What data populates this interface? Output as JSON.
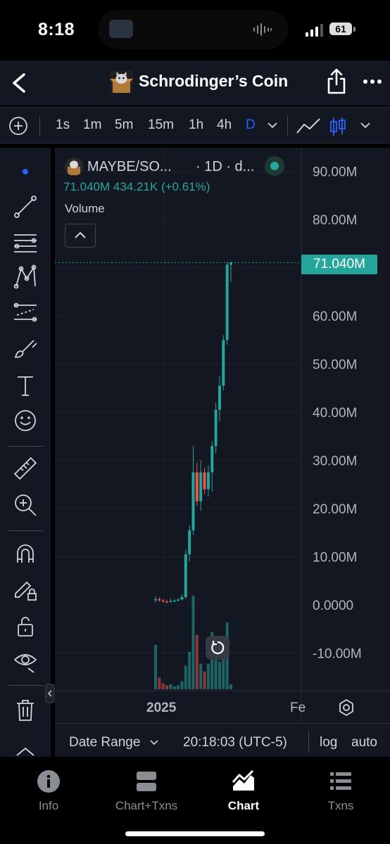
{
  "status_bar": {
    "time": "8:18",
    "battery": "61"
  },
  "header": {
    "title": "Schrodinger’s Coin",
    "back_icon": "chevron-left-icon",
    "share_icon": "share-icon",
    "more_icon": "more-icon"
  },
  "toolbar": {
    "timeframes": [
      "1s",
      "1m",
      "5m",
      "15m",
      "1h",
      "4h",
      "D"
    ],
    "active_timeframe": "D"
  },
  "legend": {
    "symbol": "MAYBE/SO...",
    "timeframe": "· 1D · d...",
    "ohlc": "71.040M 434.21K (+0.61%)",
    "volume_label": "Volume"
  },
  "axis": {
    "y_labels": [
      "90.00M",
      "80.00M",
      "60.00M",
      "50.00M",
      "40.00M",
      "30.00M",
      "20.00M",
      "10.00M",
      "0.0000",
      "-10.00M"
    ],
    "x_labels": [
      "2025",
      "Fe"
    ],
    "current_price": "71.040M"
  },
  "date_bar": {
    "range": "Date Range",
    "time": "20:18:03 (UTC-5)",
    "log": "log",
    "auto": "auto"
  },
  "tabs": [
    {
      "label": "Info",
      "icon": "info-icon"
    },
    {
      "label": "Chart+Txns",
      "icon": "split-view-icon"
    },
    {
      "label": "Chart",
      "icon": "chart-icon",
      "active": true
    },
    {
      "label": "Txns",
      "icon": "list-icon"
    }
  ],
  "colors": {
    "background": "#131722",
    "up": "#26a69a",
    "down": "#ef5350",
    "accent": "#2962ff"
  },
  "chart_data": {
    "type": "candlestick",
    "ylim": [
      -15000000,
      95000000
    ],
    "y_ticks": [
      90000000,
      80000000,
      60000000,
      50000000,
      40000000,
      30000000,
      20000000,
      10000000,
      0,
      -10000000
    ],
    "candles": [
      {
        "o": 1000000,
        "h": 1800000,
        "l": 500000,
        "c": 1200000
      },
      {
        "o": 1200000,
        "h": 1600000,
        "l": 700000,
        "c": 900000
      },
      {
        "o": 900000,
        "h": 1300000,
        "l": 500000,
        "c": 700000
      },
      {
        "o": 700000,
        "h": 1100000,
        "l": 400000,
        "c": 600000
      },
      {
        "o": 600000,
        "h": 1300000,
        "l": 500000,
        "c": 800000
      },
      {
        "o": 800000,
        "h": 1200000,
        "l": 600000,
        "c": 900000
      },
      {
        "o": 900000,
        "h": 1400000,
        "l": 700000,
        "c": 1100000
      },
      {
        "o": 1100000,
        "h": 2200000,
        "l": 900000,
        "c": 1600000
      },
      {
        "o": 1600000,
        "h": 11500000,
        "l": 1300000,
        "c": 10500000
      },
      {
        "o": 10500000,
        "h": 16500000,
        "l": 9000000,
        "c": 15500000
      },
      {
        "o": 15500000,
        "h": 33000000,
        "l": 14500000,
        "c": 27500000
      },
      {
        "o": 27500000,
        "h": 29500000,
        "l": 20500000,
        "c": 21500000
      },
      {
        "o": 21500000,
        "h": 30000000,
        "l": 19500000,
        "c": 27500000
      },
      {
        "o": 27500000,
        "h": 28500000,
        "l": 23000000,
        "c": 24000000
      },
      {
        "o": 24000000,
        "h": 29000000,
        "l": 22500000,
        "c": 27500000
      },
      {
        "o": 27500000,
        "h": 34000000,
        "l": 23500000,
        "c": 33000000
      },
      {
        "o": 33000000,
        "h": 42000000,
        "l": 31500000,
        "c": 40500000
      },
      {
        "o": 40500000,
        "h": 47500000,
        "l": 38000000,
        "c": 45500000
      },
      {
        "o": 45500000,
        "h": 56000000,
        "l": 44500000,
        "c": 55000000
      },
      {
        "o": 55000000,
        "h": 71000000,
        "l": 54000000,
        "c": 70600000
      },
      {
        "o": 70600000,
        "h": 71200000,
        "l": 67000000,
        "c": 71040000
      }
    ],
    "volumes": [
      0.45,
      0.12,
      0.06,
      0.04,
      0.05,
      0.03,
      0.04,
      0.08,
      0.24,
      0.38,
      0.95,
      0.55,
      0.26,
      0.18,
      0.26,
      0.58,
      0.32,
      0.28,
      0.42,
      0.68,
      0.05
    ]
  }
}
